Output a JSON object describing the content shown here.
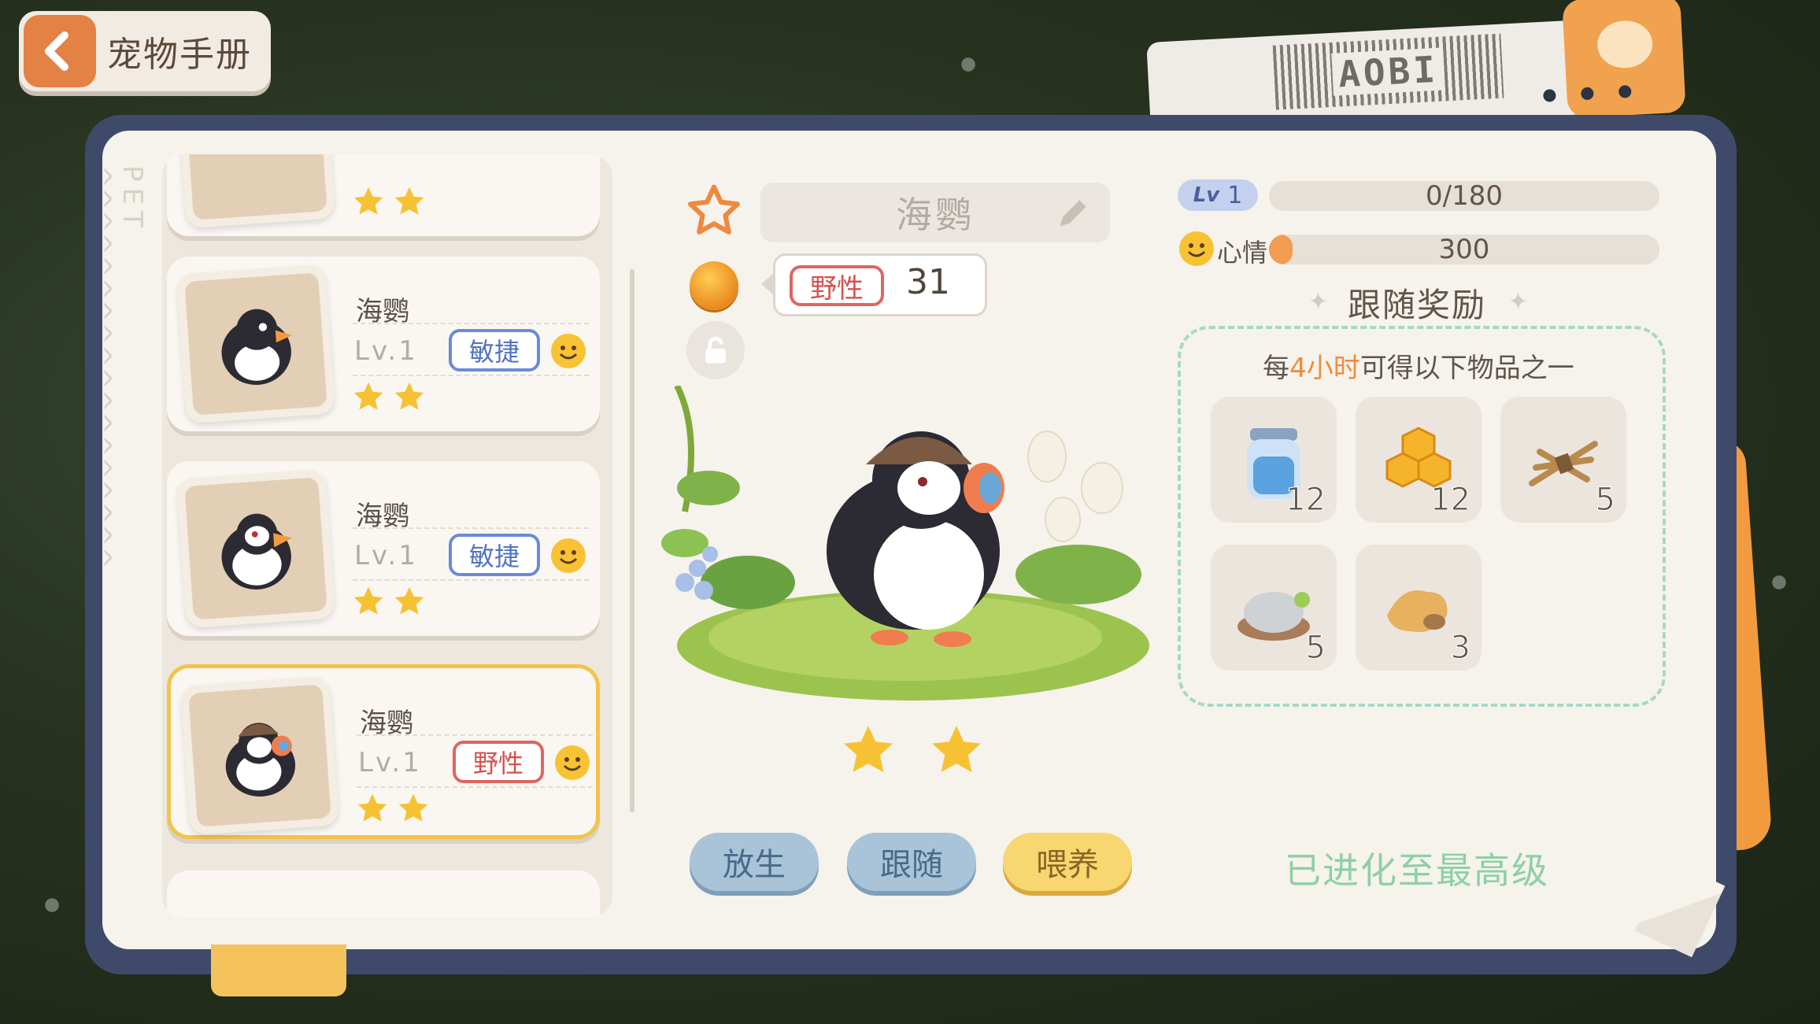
{
  "header": {
    "back_label": "宠物手册",
    "tag_code": "AOBI"
  },
  "side_label": "PET",
  "pet_list": [
    {
      "name": "",
      "level": "",
      "trait": "",
      "stars": 2
    },
    {
      "name": "海鹦",
      "level": "Lv.1",
      "trait": "敏捷",
      "trait_type": "agile",
      "stars": 2
    },
    {
      "name": "海鹦",
      "level": "Lv.1",
      "trait": "敏捷",
      "trait_type": "agile",
      "stars": 2
    },
    {
      "name": "海鹦",
      "level": "Lv.1",
      "trait": "野性",
      "trait_type": "wild",
      "stars": 2,
      "selected": true
    }
  ],
  "detail": {
    "name": "海鹦",
    "trait": "野性",
    "trait_value": "31",
    "stars": 2,
    "buttons": {
      "release": "放生",
      "follow": "跟随",
      "feed": "喂养"
    }
  },
  "stats": {
    "lv_label": "Lv",
    "level": "1",
    "exp_text": "0/180",
    "mood_label": "心情",
    "mood_value": "300",
    "mood_fill_fraction": 0.06
  },
  "reward": {
    "title": "跟随奖励",
    "subtitle_prefix": "每",
    "subtitle_highlight": "4小时",
    "subtitle_suffix": "可得以下物品之一",
    "items": [
      {
        "icon": "water-jar-icon",
        "count": "12"
      },
      {
        "icon": "honeycomb-icon",
        "count": "12"
      },
      {
        "icon": "wheat-bundle-icon",
        "count": "5"
      },
      {
        "icon": "salt-bowl-icon",
        "count": "5"
      },
      {
        "icon": "ginger-root-icon",
        "count": "3"
      }
    ]
  },
  "evolution_status": "已进化至最高级",
  "colors": {
    "accent_orange": "#e48145",
    "frame": "#3f4a6b",
    "wild": "#d4514e",
    "agile": "#5173c2",
    "evolved_text": "#8ed0a6"
  }
}
